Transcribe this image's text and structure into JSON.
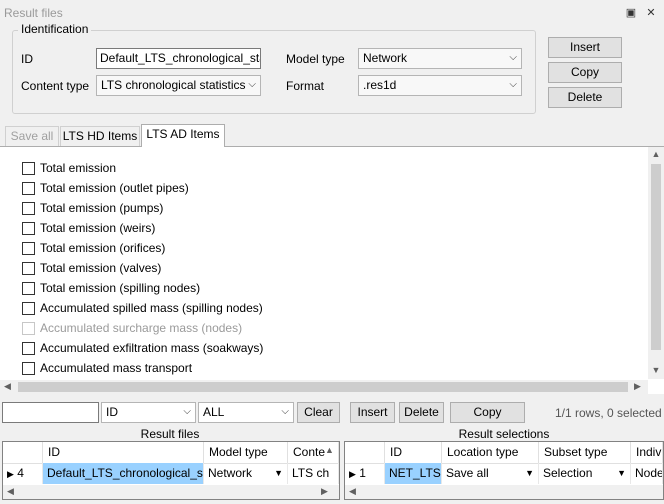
{
  "window": {
    "title": "Result files"
  },
  "identification": {
    "legend": "Identification",
    "id_label": "ID",
    "id_value": "Default_LTS_chronological_statis",
    "content_type_label": "Content type",
    "content_type_value": "LTS chronological statistics",
    "model_type_label": "Model type",
    "model_type_value": "Network",
    "format_label": "Format",
    "format_value": ".res1d"
  },
  "side_buttons": {
    "insert": "Insert",
    "copy": "Copy",
    "delete": "Delete"
  },
  "tabs": [
    {
      "label": "Save all",
      "state": "disabled"
    },
    {
      "label": "LTS HD Items",
      "state": "normal"
    },
    {
      "label": "LTS AD Items",
      "state": "active"
    }
  ],
  "items": [
    {
      "label": "Total emission",
      "enabled": true
    },
    {
      "label": "Total emission (outlet pipes)",
      "enabled": true
    },
    {
      "label": "Total emission (pumps)",
      "enabled": true
    },
    {
      "label": "Total emission (weirs)",
      "enabled": true
    },
    {
      "label": "Total emission (orifices)",
      "enabled": true
    },
    {
      "label": "Total emission (valves)",
      "enabled": true
    },
    {
      "label": "Total emission (spilling nodes)",
      "enabled": true
    },
    {
      "label": "Accumulated spilled mass (spilling nodes)",
      "enabled": true
    },
    {
      "label": "Accumulated surcharge mass (nodes)",
      "enabled": false
    },
    {
      "label": "Accumulated exfiltration mass (soakways)",
      "enabled": true
    },
    {
      "label": "Accumulated mass transport",
      "enabled": true
    }
  ],
  "filter": {
    "search_value": "",
    "field_value": "ID",
    "scope_value": "ALL",
    "clear": "Clear"
  },
  "selections_toolbar": {
    "insert": "Insert",
    "delete": "Delete",
    "copy": "Copy",
    "status": "1/1 rows, 0 selected"
  },
  "result_files_grid": {
    "caption": "Result files",
    "headers": [
      "ID",
      "Model type",
      "Conte"
    ],
    "row": {
      "num": "4",
      "id": "Default_LTS_chronological_s...",
      "model_type": "Network",
      "content": "LTS ch"
    }
  },
  "result_selections_grid": {
    "caption": "Result selections",
    "headers": [
      "ID",
      "Location type",
      "Subset type",
      "Indivi"
    ],
    "row": {
      "num": "1",
      "id": "NET_LTSC",
      "location_type": "Save all",
      "subset_type": "Selection",
      "indiv": "Node"
    }
  }
}
